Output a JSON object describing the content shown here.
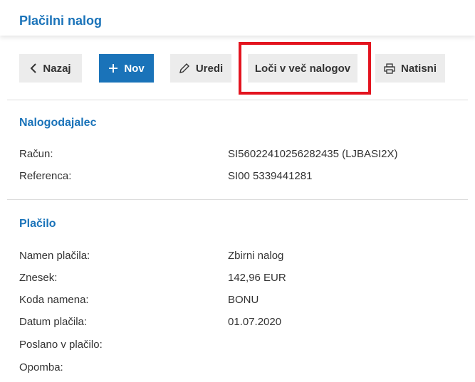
{
  "header": {
    "title": "Plačilni nalog"
  },
  "toolbar": {
    "back_label": "Nazaj",
    "new_label": "Nov",
    "edit_label": "Uredi",
    "split_label": "Loči v več nalogov",
    "print_label": "Natisni"
  },
  "payer_section": {
    "title": "Nalogodajalec",
    "rows": [
      {
        "label": "Račun:",
        "value": "SI56022410256282435 (LJBASI2X)"
      },
      {
        "label": "Referenca:",
        "value": "SI00 5339441281"
      }
    ]
  },
  "payment_section": {
    "title": "Plačilo",
    "rows": [
      {
        "label": "Namen plačila:",
        "value": "Zbirni nalog"
      },
      {
        "label": "Znesek:",
        "value": "142,96 EUR"
      },
      {
        "label": "Koda namena:",
        "value": "BONU"
      },
      {
        "label": "Datum plačila:",
        "value": "01.07.2020"
      },
      {
        "label": "Poslano v plačilo:",
        "value": ""
      },
      {
        "label": "Opomba:",
        "value": ""
      }
    ]
  },
  "colors": {
    "accent": "#1a73b9",
    "highlight": "#e3141f",
    "button_bg": "#ececec"
  },
  "icons": [
    "chevron-left-icon",
    "plus-icon",
    "pencil-icon",
    "printer-icon"
  ]
}
